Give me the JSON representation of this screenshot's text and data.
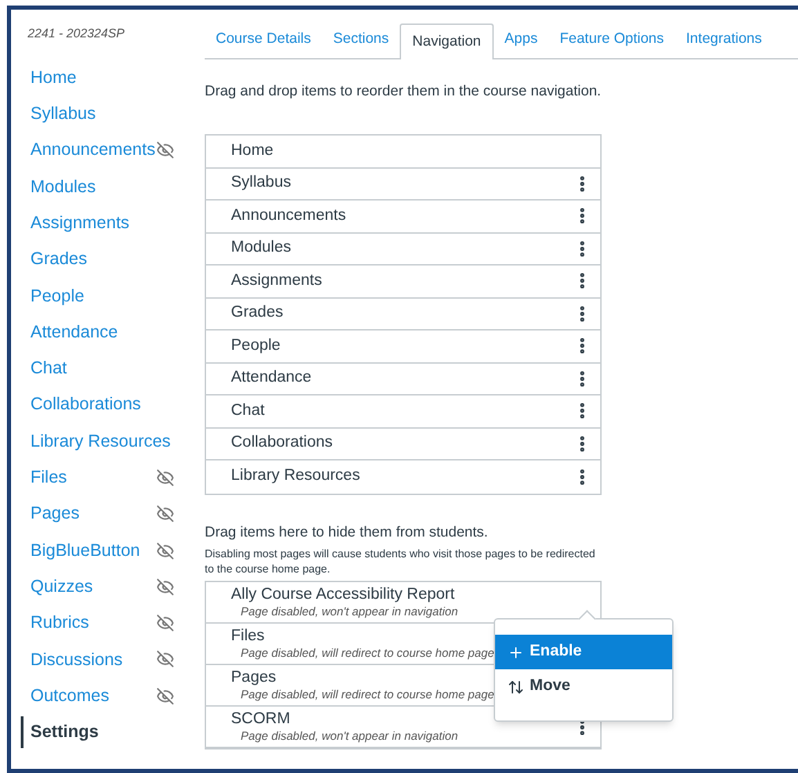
{
  "course_code": "2241 - 202324SP",
  "sidebar": {
    "items": [
      {
        "label": "Home",
        "hidden": false,
        "selected": false
      },
      {
        "label": "Syllabus",
        "hidden": false,
        "selected": false
      },
      {
        "label": "Announcements",
        "hidden": true,
        "selected": false
      },
      {
        "label": "Modules",
        "hidden": false,
        "selected": false
      },
      {
        "label": "Assignments",
        "hidden": false,
        "selected": false
      },
      {
        "label": "Grades",
        "hidden": false,
        "selected": false
      },
      {
        "label": "People",
        "hidden": false,
        "selected": false
      },
      {
        "label": "Attendance",
        "hidden": false,
        "selected": false
      },
      {
        "label": "Chat",
        "hidden": false,
        "selected": false
      },
      {
        "label": "Collaborations",
        "hidden": false,
        "selected": false
      },
      {
        "label": "Library Resources",
        "hidden": false,
        "selected": false
      },
      {
        "label": "Files",
        "hidden": true,
        "selected": false
      },
      {
        "label": "Pages",
        "hidden": true,
        "selected": false
      },
      {
        "label": "BigBlueButton",
        "hidden": true,
        "selected": false
      },
      {
        "label": "Quizzes",
        "hidden": true,
        "selected": false
      },
      {
        "label": "Rubrics",
        "hidden": true,
        "selected": false
      },
      {
        "label": "Discussions",
        "hidden": true,
        "selected": false
      },
      {
        "label": "Outcomes",
        "hidden": true,
        "selected": false
      },
      {
        "label": "Settings",
        "hidden": false,
        "selected": true
      }
    ]
  },
  "tabs": [
    {
      "label": "Course Details",
      "selected": false
    },
    {
      "label": "Sections",
      "selected": false
    },
    {
      "label": "Navigation",
      "selected": true
    },
    {
      "label": "Apps",
      "selected": false
    },
    {
      "label": "Feature Options",
      "selected": false
    },
    {
      "label": "Integrations",
      "selected": false
    }
  ],
  "instructions": "Drag and drop items to reorder them in the course navigation.",
  "enabled_list": {
    "items": [
      {
        "label": "Home",
        "has_menu": false
      },
      {
        "label": "Syllabus",
        "has_menu": true
      },
      {
        "label": "Announcements",
        "has_menu": true
      },
      {
        "label": "Modules",
        "has_menu": true
      },
      {
        "label": "Assignments",
        "has_menu": true
      },
      {
        "label": "Grades",
        "has_menu": true
      },
      {
        "label": "People",
        "has_menu": true
      },
      {
        "label": "Attendance",
        "has_menu": true
      },
      {
        "label": "Chat",
        "has_menu": true
      },
      {
        "label": "Collaborations",
        "has_menu": true
      },
      {
        "label": "Library Resources",
        "has_menu": true
      }
    ]
  },
  "hidden_section": {
    "title": "Drag items here to hide them from students.",
    "note": "Disabling most pages will cause students who visit those pages to be redirected to the course home page.",
    "items": [
      {
        "label": "Ally Course Accessibility Report",
        "status": "Page disabled, won't appear in navigation",
        "has_menu": false
      },
      {
        "label": "Files",
        "status": "Page disabled, will redirect to course home page",
        "has_menu": false
      },
      {
        "label": "Pages",
        "status": "Page disabled, will redirect to course home page",
        "has_menu": false
      },
      {
        "label": "SCORM",
        "status": "Page disabled, won't appear in navigation",
        "has_menu": true
      }
    ]
  },
  "popover": {
    "items": [
      {
        "label": "Enable",
        "kind": "enable",
        "selected": true
      },
      {
        "label": "Move",
        "kind": "move",
        "selected": false
      }
    ]
  }
}
